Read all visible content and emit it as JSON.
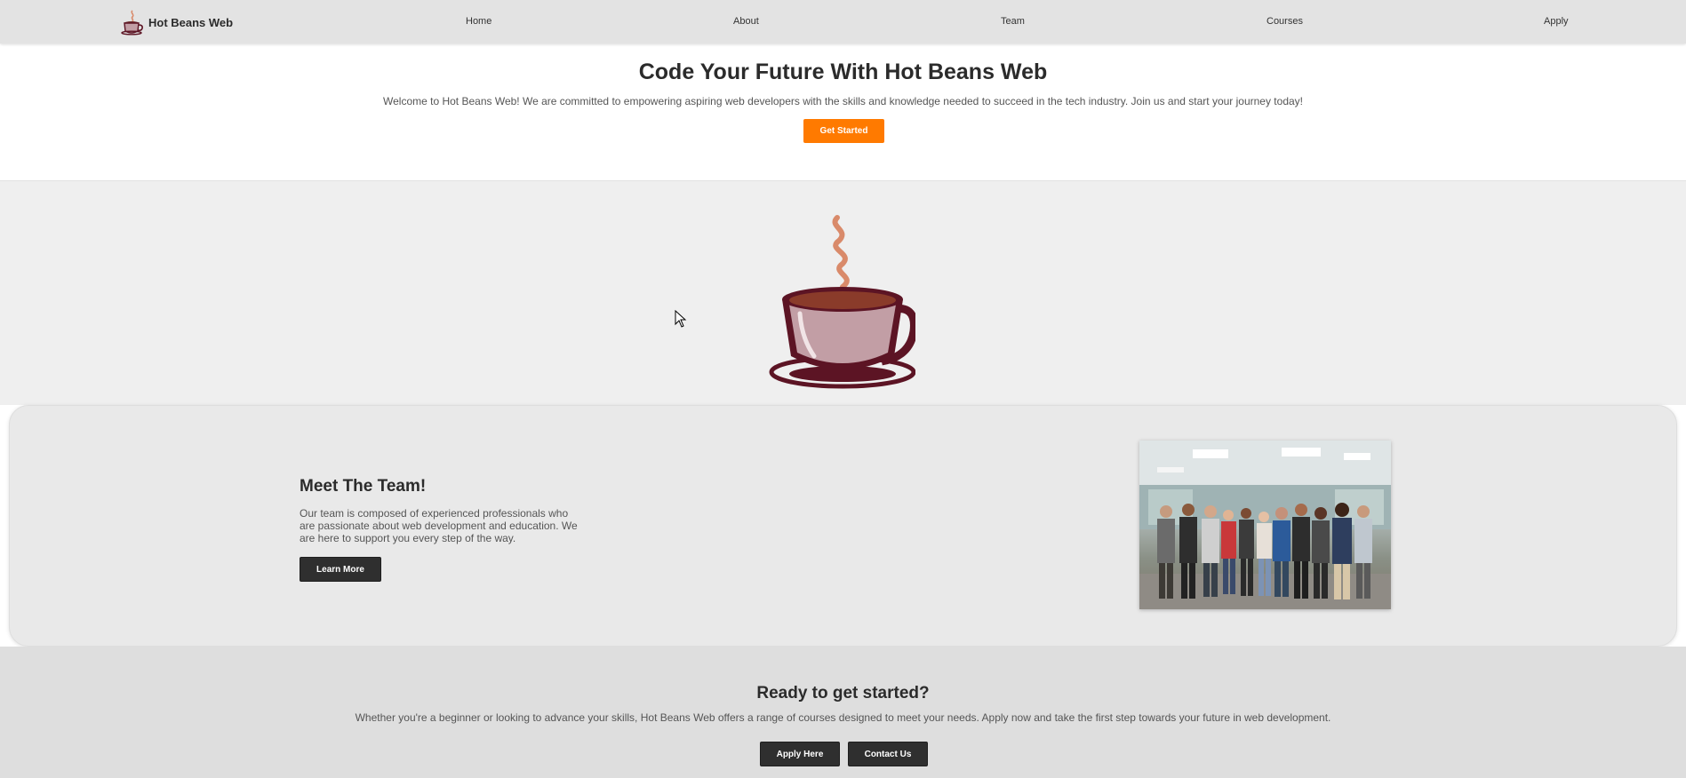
{
  "nav": {
    "brand": "Hot Beans Web",
    "links": [
      "Home",
      "About",
      "Team",
      "Courses",
      "Apply"
    ]
  },
  "hero": {
    "title": "Code Your Future With Hot Beans Web",
    "text": "Welcome to Hot Beans Web! We are committed to empowering aspiring web developers with the skills and knowledge needed to succeed in the tech industry. Join us and start your journey today!",
    "button": "Get Started"
  },
  "team": {
    "title": "Meet The Team!",
    "text": "Our team is composed of experienced professionals who are passionate about web development and education. We are here to support you every step of the way.",
    "button": "Learn More"
  },
  "cta": {
    "title": "Ready to get started?",
    "text": "Whether you're a beginner or looking to advance your skills, Hot Beans Web offers a range of courses designed to meet your needs. Apply now and take the first step towards your future in web development.",
    "apply_button": "Apply Here",
    "contact_button": "Contact Us"
  },
  "icons": {
    "logo": "coffee-cup-icon",
    "cursor": "mouse-pointer-icon"
  },
  "colors": {
    "accent": "#ff7a00",
    "dark_button": "#2f2f2f",
    "cup_body": "#5c1424",
    "cup_fill": "#c29ea5",
    "steam": "#d98a6a"
  }
}
